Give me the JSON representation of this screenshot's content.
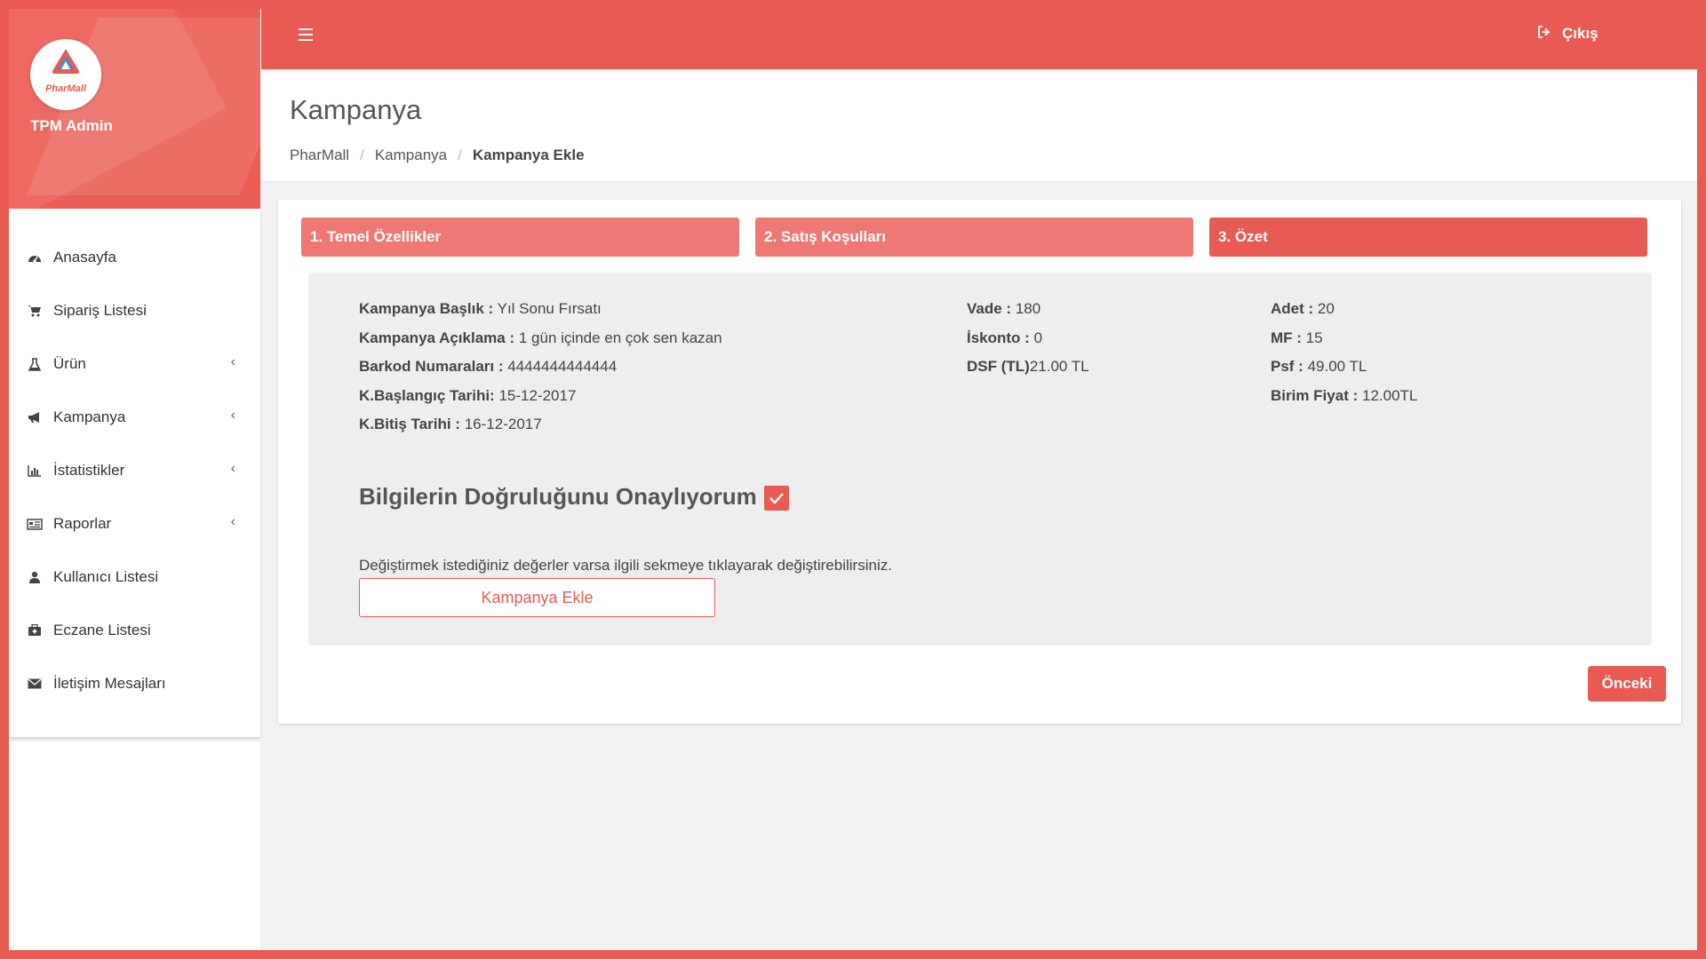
{
  "brand": {
    "logo_text": "PharMall",
    "name": "TPM Admin"
  },
  "topbar": {
    "logout_label": "Çıkış"
  },
  "page": {
    "title": "Kampanya",
    "breadcrumb": [
      "PharMall",
      "Kampanya",
      "Kampanya Ekle"
    ]
  },
  "sidebar": {
    "items": [
      {
        "label": "Anasayfa",
        "icon": "dashboard-icon"
      },
      {
        "label": "Sipariş Listesi",
        "icon": "cart-icon"
      },
      {
        "label": "Ürün",
        "icon": "flask-icon",
        "has_submenu": true
      },
      {
        "label": "Kampanya",
        "icon": "bullhorn-icon",
        "has_submenu": true
      },
      {
        "label": "İstatistikler",
        "icon": "bar-chart-icon",
        "has_submenu": true
      },
      {
        "label": "Raporlar",
        "icon": "report-icon",
        "has_submenu": true
      },
      {
        "label": "Kullanıcı Listesi",
        "icon": "user-icon"
      },
      {
        "label": "Eczane Listesi",
        "icon": "medkit-icon"
      },
      {
        "label": "İletişim Mesajları",
        "icon": "envelope-icon"
      }
    ]
  },
  "steps": [
    "1. Temel Özellikler",
    "2. Satış Koşulları",
    "3. Özet"
  ],
  "summary": {
    "col1": [
      {
        "label": "Kampanya Başlık :",
        "value": "Yıl Sonu Fırsatı"
      },
      {
        "label": "Kampanya Açıklama :",
        "value": "1 gün içinde en çok sen kazan"
      },
      {
        "label": "Barkod Numaraları :",
        "value": "4444444444444"
      },
      {
        "label": "K.Başlangıç Tarihi:",
        "value": "15-12-2017"
      },
      {
        "label": "K.Bitiş Tarihi :",
        "value": "16-12-2017"
      }
    ],
    "col2": [
      {
        "label": "Vade :",
        "value": "180"
      },
      {
        "label": "İskonto :",
        "value": "0"
      },
      {
        "label": "DSF (TL)",
        "value": "21.00 TL"
      }
    ],
    "col3": [
      {
        "label": "Adet :",
        "value": "20"
      },
      {
        "label": "MF :",
        "value": "15"
      },
      {
        "label": "Psf :",
        "value": "49.00 TL"
      },
      {
        "label": "Birim Fiyat :",
        "value": "12.00TL"
      }
    ],
    "confirm_label": "Bilgilerin Doğruluğunu Onaylıyorum",
    "confirm_checked": true,
    "hint": "Değiştirmek istediğiniz değerler varsa ilgili sekmeye tıklayarak değiştirebilirsiniz.",
    "submit_label": "Kampanya Ekle"
  },
  "prev_label": "Önceki",
  "colors": {
    "accent": "#e95a52",
    "step_done": "#ee7874"
  }
}
